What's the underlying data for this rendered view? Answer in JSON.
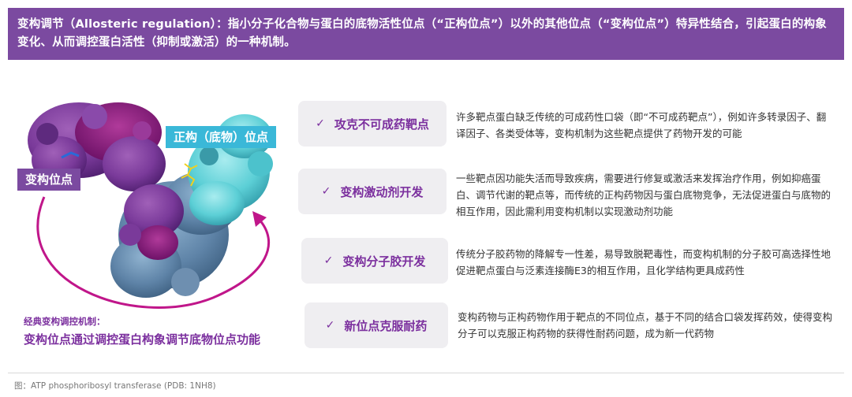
{
  "banner": {
    "text": "变构调节（Allosteric regulation）：指小分子化合物与蛋白的底物活性位点（“正构位点”）以外的其他位点（“变构位点”）特异性结合，引起蛋白的构象变化、从而调控蛋白活性（抑制或激活）的一种机制。"
  },
  "figure": {
    "allosteric_label": "变构位点",
    "orthosteric_label": "正构（底物）位点",
    "caption_small": "经典变构调控机制：",
    "caption_big": "变构位点通过调控蛋白构象调节底物位点功能"
  },
  "items": [
    {
      "title": "攻克不可成药靶点",
      "desc": "许多靶点蛋白缺乏传统的可成药性口袋（即“不可成药靶点”），例如许多转录因子、翻译因子、各类受体等，变构机制为这些靶点提供了药物开发的可能"
    },
    {
      "title": "变构激动剂开发",
      "desc": "一些靶点因功能失活而导致疾病，需要进行修复或激活来发挥治疗作用，例如抑癌蛋白、调节代谢的靶点等，而传统的正构药物因与蛋白底物竞争，无法促进蛋白与底物的相互作用，因此需利用变构机制以实现激动剂功能"
    },
    {
      "title": "变构分子胶开发",
      "desc": "传统分子胶药物的降解专一性差，易导致脱靶毒性，而变构机制的分子胶可高选择性地促进靶点蛋白与泛素连接酶E3的相互作用，且化学结构更具成药性"
    },
    {
      "title": "新位点克服耐药",
      "desc": "变构药物与正构药物作用于靶点的不同位点，基于不同的结合口袋发挥药效，使得变构分子可以克服正构药物的获得性耐药问题，成为新一代药物"
    }
  ],
  "check_symbol": "✓",
  "footnote": "图：ATP phosphoribosyl transferase (PDB: 1NH8)",
  "colors": {
    "purple": "#7b4aa0",
    "accent_text": "#7b2f9e",
    "cyan": "#3ab8d8",
    "arrow": "#c0168a",
    "card_bg": "#efeef1"
  }
}
